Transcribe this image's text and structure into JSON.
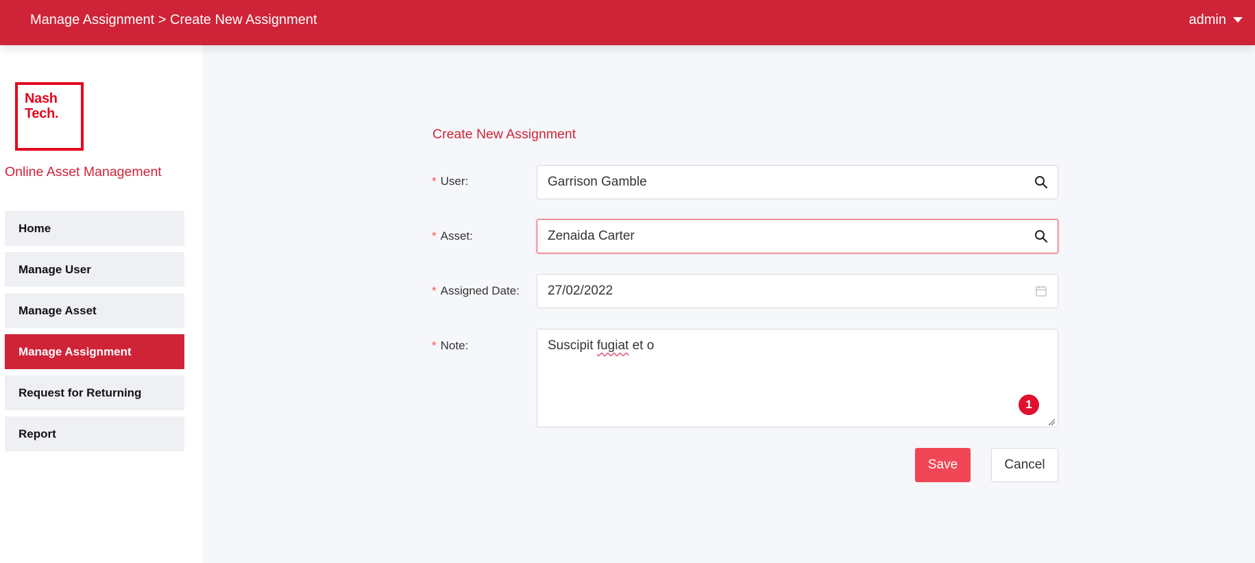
{
  "header": {
    "breadcrumb": "Manage Assignment > Create New Assignment",
    "username": "admin"
  },
  "sidebar": {
    "logo_line1": "Nash",
    "logo_line2": "Tech.",
    "app_name": "Online Asset Management",
    "items": [
      {
        "label": "Home"
      },
      {
        "label": "Manage User"
      },
      {
        "label": "Manage Asset"
      },
      {
        "label": "Manage Assignment",
        "active": true
      },
      {
        "label": "Request for Returning"
      },
      {
        "label": "Report"
      }
    ]
  },
  "form": {
    "title": "Create New Assignment",
    "user_label": "User:",
    "user_value": "Garrison Gamble",
    "asset_label": "Asset:",
    "asset_value": "Zenaida Carter",
    "date_label": "Assigned Date:",
    "date_value": "27/02/2022",
    "note_label": "Note:",
    "note_value_start": "Suscipit ",
    "note_value_misspelled": "fugiat",
    "note_value_end": " et o",
    "note_badge": "1",
    "save_label": "Save",
    "cancel_label": "Cancel"
  },
  "colors": {
    "brand_red": "#cf2338",
    "save_button": "#f04655",
    "active_nav": "#cf2338"
  },
  "icons": {
    "user_search": "search-icon",
    "asset_search": "search-icon",
    "date_picker": "calendar-icon",
    "user_menu": "caret-down-icon"
  }
}
